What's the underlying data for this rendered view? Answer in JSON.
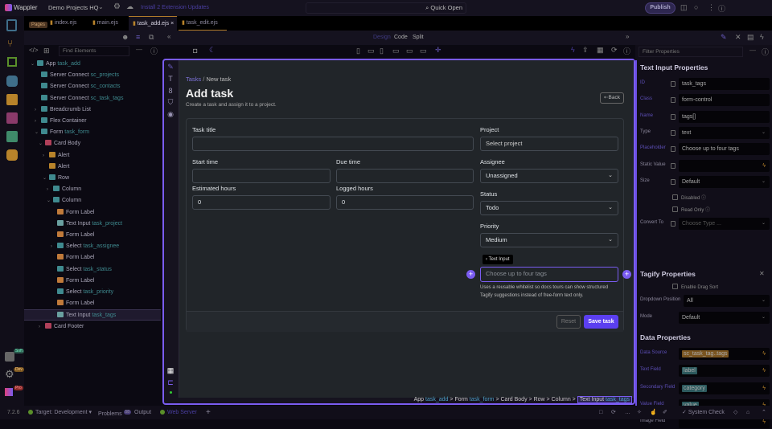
{
  "topbar": {
    "app_name": "Wappler",
    "project": "Demo Projects HQ",
    "updates": "Install 2 Extension Updates",
    "quick_open": "Quick Open",
    "publish": "Publish"
  },
  "tabs": {
    "pages_pill": "Pages",
    "items": [
      "index.ejs",
      "main.ejs",
      "task_add.ejs",
      "task_edit.ejs"
    ],
    "active": 2,
    "close": "×"
  },
  "left_panel": {
    "find_placeholder": "Find Elements",
    "tree": [
      {
        "d": 0,
        "chev": "v",
        "icon": "app",
        "color": "#3f8a8f",
        "label": "App",
        "sub": "task_add"
      },
      {
        "d": 1,
        "chev": "",
        "icon": "database",
        "color": "#3f8a8f",
        "label": "Server Connect",
        "sub": "sc_projects"
      },
      {
        "d": 1,
        "chev": "",
        "icon": "database",
        "color": "#3f8a8f",
        "label": "Server Connect",
        "sub": "sc_contacts"
      },
      {
        "d": 1,
        "chev": "",
        "icon": "database",
        "color": "#3f8a8f",
        "label": "Server Connect",
        "sub": "sc_task_tags"
      },
      {
        "d": 1,
        "chev": ">",
        "icon": "dots",
        "color": "#3f8a8f",
        "label": "Breadcrumb List",
        "sub": ""
      },
      {
        "d": 1,
        "chev": ">",
        "icon": "move",
        "color": "#3f8a8f",
        "label": "Flex Container",
        "sub": ""
      },
      {
        "d": 1,
        "chev": "v",
        "icon": "form",
        "color": "#3f8a8f",
        "label": "Form",
        "sub": "task_form"
      },
      {
        "d": 2,
        "chev": "v",
        "icon": "lines",
        "color": "#b0405a",
        "label": "Card Body",
        "sub": ""
      },
      {
        "d": 3,
        "chev": ">",
        "icon": "alert",
        "color": "#b8832a",
        "label": "Alert",
        "sub": ""
      },
      {
        "d": 3,
        "chev": "",
        "icon": "alert",
        "color": "#b8832a",
        "label": "Alert",
        "sub": ""
      },
      {
        "d": 3,
        "chev": "v",
        "icon": "dots",
        "color": "#3f8a8f",
        "label": "Row",
        "sub": ""
      },
      {
        "d": 4,
        "chev": ">",
        "icon": "column",
        "color": "#3f8a8f",
        "label": "Column",
        "sub": ""
      },
      {
        "d": 4,
        "chev": "v",
        "icon": "column",
        "color": "#3f8a8f",
        "label": "Column",
        "sub": ""
      },
      {
        "d": 5,
        "chev": "",
        "icon": "label",
        "color": "#c07a3a",
        "label": "Form Label",
        "sub": ""
      },
      {
        "d": 5,
        "chev": "",
        "icon": "pencil",
        "color": "#6aa0a0",
        "label": "Text Input",
        "sub": "task_project"
      },
      {
        "d": 5,
        "chev": "",
        "icon": "label",
        "color": "#c07a3a",
        "label": "Form Label",
        "sub": ""
      },
      {
        "d": 5,
        "chev": ">",
        "icon": "select",
        "color": "#3f8a8f",
        "label": "Select",
        "sub": "task_assignee"
      },
      {
        "d": 5,
        "chev": "",
        "icon": "label",
        "color": "#c07a3a",
        "label": "Form Label",
        "sub": ""
      },
      {
        "d": 5,
        "chev": "",
        "icon": "select",
        "color": "#3f8a8f",
        "label": "Select",
        "sub": "task_status"
      },
      {
        "d": 5,
        "chev": "",
        "icon": "label",
        "color": "#c07a3a",
        "label": "Form Label",
        "sub": ""
      },
      {
        "d": 5,
        "chev": "",
        "icon": "select",
        "color": "#3f8a8f",
        "label": "Select",
        "sub": "task_priority"
      },
      {
        "d": 5,
        "chev": "",
        "icon": "label",
        "color": "#c07a3a",
        "label": "Form Label",
        "sub": ""
      },
      {
        "d": 5,
        "chev": "",
        "icon": "pencil",
        "color": "#6aa0a0",
        "label": "Text Input",
        "sub": "task_tags",
        "selected": true
      },
      {
        "d": 2,
        "chev": ">",
        "icon": "footer",
        "color": "#b0405a",
        "label": "Card Footer",
        "sub": ""
      }
    ]
  },
  "center": {
    "modes": [
      "Design",
      "Code",
      "Split"
    ],
    "breadcrumb": {
      "link": "Tasks",
      "sep": "/",
      "current": "New task"
    },
    "title": "Add task",
    "subtitle": "Create a task and assign it to a project.",
    "back": "Back",
    "form": {
      "task_title": {
        "label": "Task title",
        "value": ""
      },
      "start_time": {
        "label": "Start time",
        "value": ""
      },
      "due_time": {
        "label": "Due time",
        "value": ""
      },
      "estimated_hours": {
        "label": "Estimated hours",
        "value": "0"
      },
      "logged_hours": {
        "label": "Logged hours",
        "value": "0"
      },
      "project": {
        "label": "Project",
        "placeholder": "Select project"
      },
      "assignee": {
        "label": "Assignee",
        "value": "Unassigned"
      },
      "status": {
        "label": "Status",
        "value": "Todo"
      },
      "priority": {
        "label": "Priority",
        "value": "Medium"
      },
      "tags": {
        "tooltip": "Text Input",
        "placeholder": "Choose up to four tags",
        "help": "Uses a reusable whitelist so docs tours can show structured Tagify suggestions instead of free-form text only."
      },
      "reset": "Reset",
      "save": "Save task"
    },
    "path": {
      "items": [
        [
          "App",
          "task_add"
        ],
        [
          "Form",
          "task_form"
        ],
        [
          "Card Body",
          ""
        ],
        [
          "Row",
          ""
        ],
        [
          "Column",
          ""
        ]
      ],
      "sep": ">",
      "last": "Text Input",
      "last_sub": "task_tags"
    }
  },
  "right_panel": {
    "filter_placeholder": "Filter Properties",
    "text_input_title": "Text Input Properties",
    "props": [
      {
        "k": "ID",
        "v": "task_tags",
        "bound": true
      },
      {
        "k": "Class",
        "v": "form-control",
        "bound": true
      },
      {
        "k": "Name",
        "v": "tags[]",
        "bound": true
      },
      {
        "k": "Type",
        "v": "text",
        "caret": true
      },
      {
        "k": "Placeholder",
        "v": "Choose up to four tags",
        "bound": true
      },
      {
        "k": "Static Value",
        "v": "",
        "bolt": true
      },
      {
        "k": "Size",
        "v": "Default",
        "caret": true
      }
    ],
    "disabled": "Disabled",
    "read_only": "Read Only",
    "convert_to": {
      "k": "Convert To",
      "placeholder": "Choose Type ..."
    },
    "tagify_title": "Tagify Properties",
    "enable_drag_sort": "Enable Drag Sort",
    "dropdown_position": {
      "k": "Dropdown Position",
      "v": "All"
    },
    "mode": {
      "k": "Mode",
      "v": "Default"
    },
    "data_title": "Data Properties",
    "data_props": [
      {
        "k": "Data Source",
        "v": "sc_task_tag..tags",
        "chip": "#7a5520"
      },
      {
        "k": "Text Field",
        "v": "label",
        "chip": "#2d5a5e"
      },
      {
        "k": "Secondary Field",
        "v": "category",
        "chip": "#2d5a5e"
      },
      {
        "k": "Value Field",
        "v": "value",
        "chip": "#2d5a5e"
      },
      {
        "k": "Image Field",
        "v": "",
        "chip": ""
      }
    ]
  },
  "rail": {
    "badges": [
      "Soft",
      "Dev",
      "Pro"
    ]
  },
  "status": {
    "version": "7.2.6",
    "target": "Target: Development",
    "problems": "Problems",
    "problems_count": "58",
    "output": "Output",
    "web_server": "Web Server",
    "add": "+",
    "system_check": "System Check"
  }
}
